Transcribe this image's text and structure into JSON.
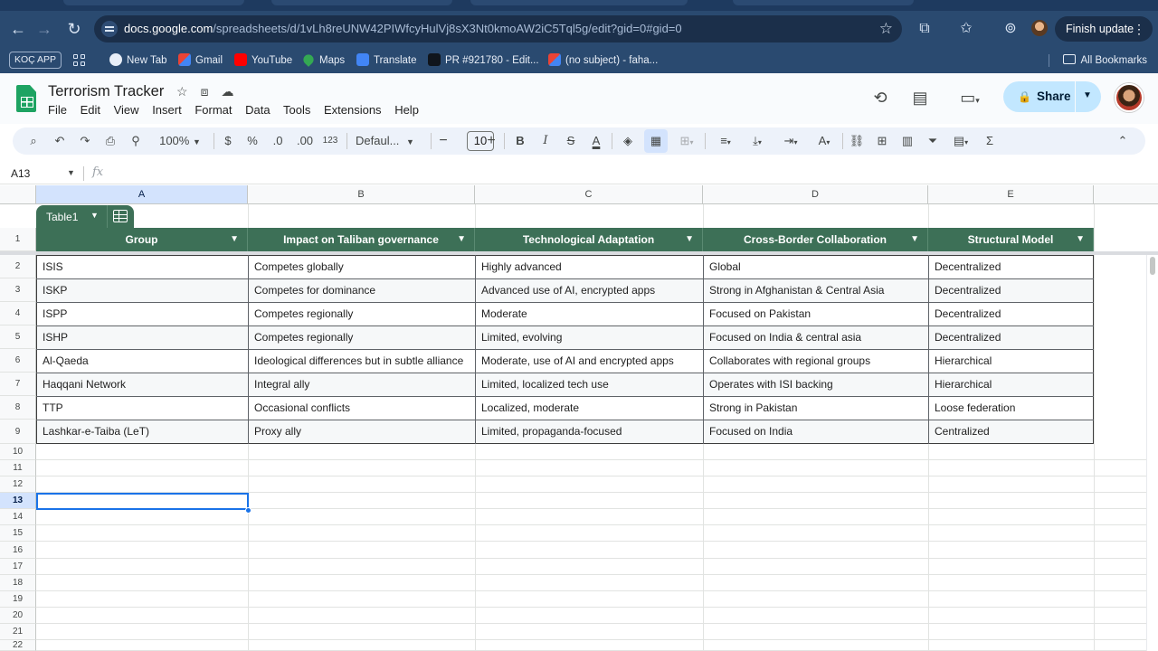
{
  "browser": {
    "url_host": "docs.google.com",
    "url_path": "/spreadsheets/d/1vLh8reUNW42PIWfcyHulVj8sX3Nt0kmoAW2iC5Tql5g/edit?gid=0#gid=0",
    "finish_update": "Finish update",
    "colors": {
      "chrome": "#2a4a70",
      "omnibox": "#1b2f4a"
    }
  },
  "bookmarks": {
    "app": "KOÇ APP",
    "items": [
      "New Tab",
      "Gmail",
      "YouTube",
      "Maps",
      "Translate",
      "PR #921780 - Edit...",
      "(no subject) - faha..."
    ],
    "all": "All Bookmarks"
  },
  "doc": {
    "title": "Terrorism Tracker",
    "menu": [
      "File",
      "Edit",
      "View",
      "Insert",
      "Format",
      "Data",
      "Tools",
      "Extensions",
      "Help"
    ],
    "share": "Share"
  },
  "toolbar": {
    "zoom": "100%",
    "currency": "$",
    "percent": "%",
    "dec_decrease": ".0",
    "dec_increase": ".00",
    "number_format": "123",
    "font": "Defaul...",
    "font_size": "10"
  },
  "formula_bar": {
    "name_box": "A13",
    "fx": "fx"
  },
  "columns": [
    "A",
    "B",
    "C",
    "D",
    "E"
  ],
  "rows": [
    "1",
    "2",
    "3",
    "4",
    "5",
    "6",
    "7",
    "8",
    "9",
    "10",
    "11",
    "12",
    "13",
    "14",
    "15",
    "16",
    "17",
    "18",
    "19",
    "20",
    "21",
    "22"
  ],
  "active_row": "13",
  "table": {
    "name": "Table1",
    "headers": [
      "Group",
      "Impact on Taliban governance",
      "Technological Adaptation",
      "Cross-Border Collaboration",
      "Structural Model"
    ],
    "rows": [
      [
        "ISIS",
        "Competes globally",
        "Highly advanced",
        "Global",
        "Decentralized"
      ],
      [
        "ISKP",
        "Competes for dominance",
        "Advanced use of AI, encrypted apps",
        "Strong in Afghanistan & Central Asia",
        "Decentralized"
      ],
      [
        "ISPP",
        "Competes regionally",
        "Moderate",
        "Focused on Pakistan",
        "Decentralized"
      ],
      [
        "ISHP",
        "Competes regionally",
        "Limited, evolving",
        "Focused on India & central asia",
        "Decentralized"
      ],
      [
        "Al-Qaeda",
        "Ideological differences but in subtle alliance",
        "Moderate, use of AI and encrypted apps",
        "Collaborates with regional groups",
        "Hierarchical"
      ],
      [
        "Haqqani Network",
        "Integral ally",
        "Limited, localized tech use",
        "Operates with ISI backing",
        "Hierarchical"
      ],
      [
        "TTP",
        "Occasional conflicts",
        "Localized, moderate",
        "Strong in Pakistan",
        "Loose federation"
      ],
      [
        "Lashkar-e-Taiba (LeT)",
        "Proxy ally",
        "Limited, propaganda-focused",
        "Focused on India",
        "Centralized"
      ]
    ],
    "header_color": "#3d7057"
  }
}
